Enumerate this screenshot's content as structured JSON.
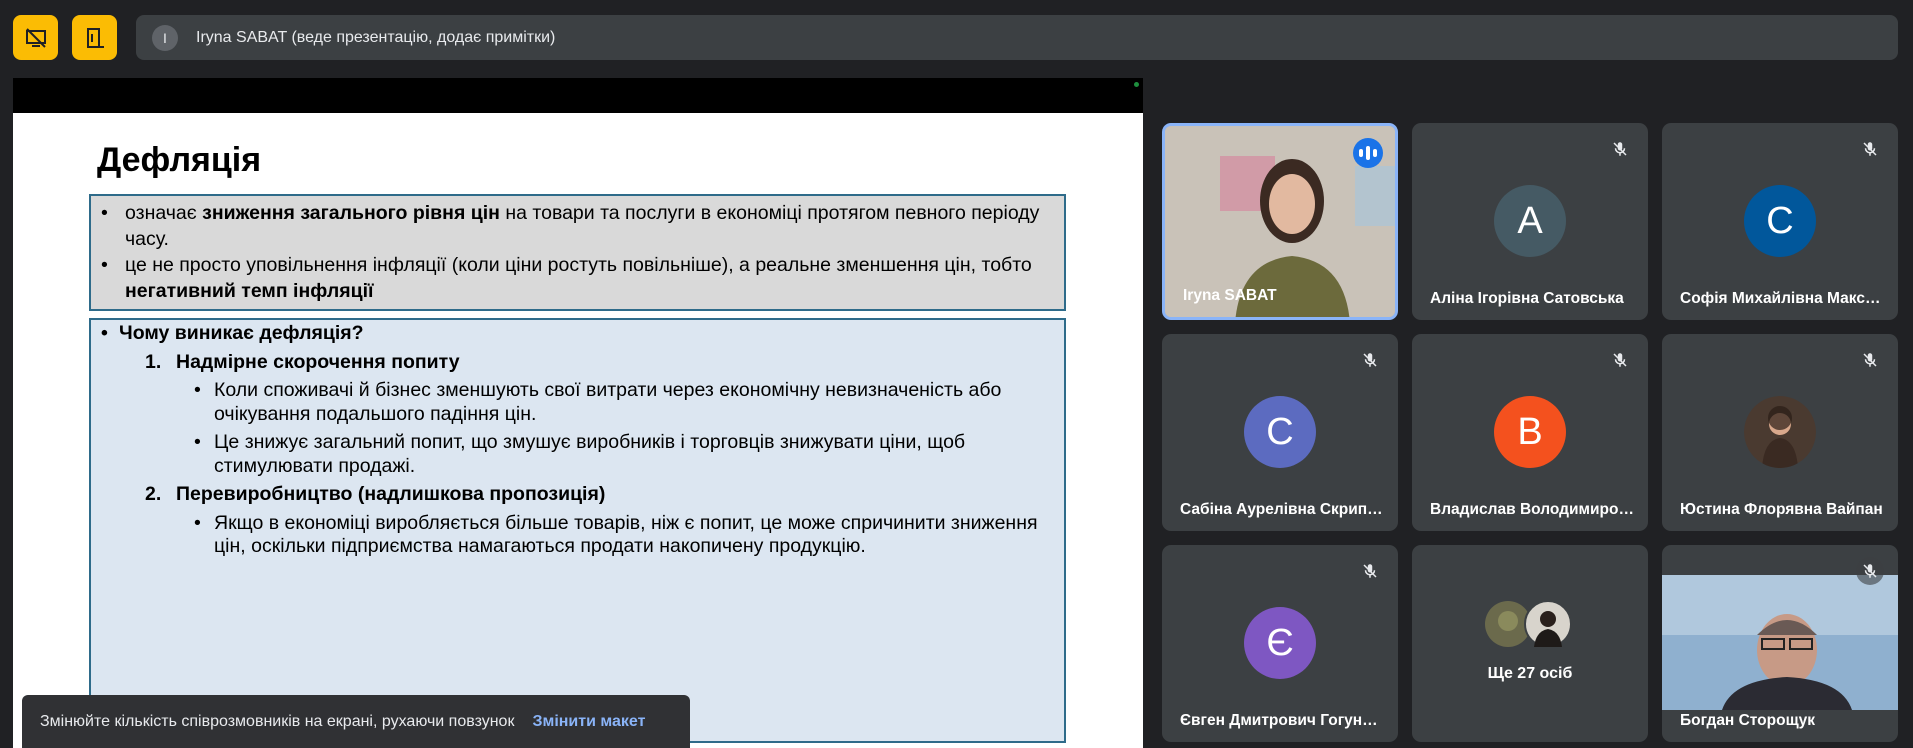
{
  "topbar": {
    "presenter_initial": "I",
    "presenter_text": "Iryna SABAT (веде презентацію, додає примітки)"
  },
  "slide": {
    "title": "Дефляція",
    "box1": {
      "b1_pre": "означає ",
      "b1_bold": "зниження загального рівня цін",
      "b1_post": " на товари та послуги в економіці протягом певного періоду часу.",
      "b2_pre": "це не просто уповільнення інфляції (коли ціни ростуть повільніше), а реальне зменшення цін, тобто ",
      "b2_bold": "негативний темп інфляції"
    },
    "box2": {
      "question": "Чому виникає дефляція?",
      "item1_num": "1.",
      "item1_title": "Надмірне скорочення попиту",
      "item1_b1": "Коли споживачі й бізнес зменшують свої витрати через економічну невизначеність або очікування подальшого падіння цін.",
      "item1_b2": "Це знижує загальний попит, що змушує виробників і торговців знижувати ціни, щоб стимулювати продажі.",
      "item2_num": "2.",
      "item2_title": "Перевиробництво (надлишкова пропозиція)",
      "item2_b1": "Якщо в економіці виробляється більше товарів, ніж є попит, це може спричинити зниження цін, оскільки підприємства намагаються продати накопичену продукцію."
    }
  },
  "toast": {
    "text": "Змінюйте кількість співрозмовників на екрані, рухаючи повзунок",
    "action": "Змінити макет"
  },
  "participants": [
    {
      "name": "Iryna SABAT",
      "initial": "",
      "speaking": true
    },
    {
      "name": "Аліна Ігорівна Сатовська",
      "initial": "А",
      "color": "#455a64"
    },
    {
      "name": "Софія Михайлівна Максимович",
      "initial": "С",
      "color": "#01579b"
    },
    {
      "name": "Сабіна Аурелівна Скрипник",
      "initial": "С",
      "color": "#5c6bc0"
    },
    {
      "name": "Владислав Володимирович",
      "initial": "В",
      "color": "#f4511e"
    },
    {
      "name": "Юстина Флорявна Вайпан",
      "initial": ""
    },
    {
      "name": "Євген Дмитрович Гогунський",
      "initial": "Є",
      "color": "#7e57c2"
    },
    {
      "name": "Ще 27 осіб",
      "initial": ""
    },
    {
      "name": "Богдан Сторощук",
      "initial": ""
    }
  ],
  "icons": {
    "btn1": "hide-presentation-icon",
    "btn2": "leave-presentation-icon",
    "muted": "mic-off-icon",
    "speaking": "audio-level-icon"
  }
}
